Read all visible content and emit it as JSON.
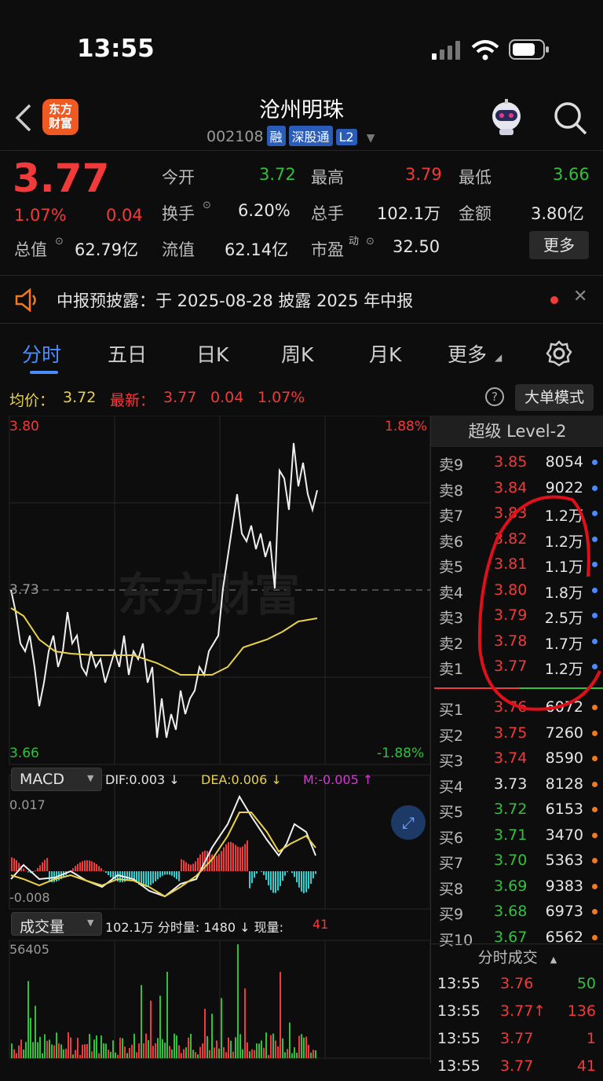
{
  "status_bar": {
    "time": "13:55"
  },
  "header": {
    "logo_text": "东方\n财富",
    "stock_name": "沧州明珠",
    "stock_code": "002108",
    "badges": [
      "融",
      "深股通",
      "L2"
    ]
  },
  "quote": {
    "price": "3.77",
    "change_pct": "1.07%",
    "change": "0.04",
    "fields": [
      {
        "label": "今开",
        "value": "3.72",
        "color": "green"
      },
      {
        "label": "最高",
        "value": "3.79",
        "color": "red"
      },
      {
        "label": "最低",
        "value": "3.66",
        "color": "green"
      },
      {
        "label": "换手",
        "value": "6.20%",
        "color": "white"
      },
      {
        "label": "总手",
        "value": "102.1万",
        "color": "white"
      },
      {
        "label": "金额",
        "value": "3.80亿",
        "color": "white"
      },
      {
        "label": "总值",
        "value": "62.79亿",
        "color": "white"
      },
      {
        "label": "流值",
        "value": "62.14亿",
        "color": "white"
      },
      {
        "label": "市盈",
        "value": "32.50",
        "color": "white"
      }
    ],
    "pe_superscript": "动",
    "more_button": "更多"
  },
  "notice": {
    "text": "中报预披露：于 2025-08-28 披露 2025 年中报"
  },
  "tabs": [
    "分时",
    "五日",
    "日K",
    "周K",
    "月K",
    "更多"
  ],
  "active_tab": 0,
  "infobar": {
    "avg_label": "均价：",
    "avg_value": "3.72",
    "latest_label": "最新：",
    "latest_value": "3.77",
    "latest_change": "0.04",
    "latest_pct": "1.07%",
    "mode_button": "大单模式"
  },
  "price_chart": {
    "y_top": "3.80",
    "y_mid": "3.73",
    "y_bottom": "3.66",
    "pct_top": "1.88%",
    "pct_bottom": "-1.88%",
    "watermark": "东方财富"
  },
  "macd": {
    "selector": "MACD",
    "dif": "DIF:0.003 ↓",
    "dea": "DEA:0.006 ↓",
    "m": "M:-0.005 ↑",
    "y_top": "0.017",
    "y_bottom": "-0.008"
  },
  "volume": {
    "selector": "成交量",
    "summary": "102.1万 分时量: 1480 ↓ 现量:",
    "current": "41",
    "y_top": "56405"
  },
  "level2": {
    "title": "超级 Level-2",
    "asks": [
      {
        "label": "卖9",
        "price": "3.85",
        "qty": "8054"
      },
      {
        "label": "卖8",
        "price": "3.84",
        "qty": "9022"
      },
      {
        "label": "卖7",
        "price": "3.83",
        "qty": "1.2万"
      },
      {
        "label": "卖6",
        "price": "3.82",
        "qty": "1.2万"
      },
      {
        "label": "卖5",
        "price": "3.81",
        "qty": "1.1万"
      },
      {
        "label": "卖4",
        "price": "3.80",
        "qty": "1.8万"
      },
      {
        "label": "卖3",
        "price": "3.79",
        "qty": "2.5万"
      },
      {
        "label": "卖2",
        "price": "3.78",
        "qty": "1.7万"
      },
      {
        "label": "卖1",
        "price": "3.77",
        "qty": "1.2万"
      }
    ],
    "bids": [
      {
        "label": "买1",
        "price": "3.76",
        "qty": "6072",
        "color": "red"
      },
      {
        "label": "买2",
        "price": "3.75",
        "qty": "7260",
        "color": "red"
      },
      {
        "label": "买3",
        "price": "3.74",
        "qty": "8590",
        "color": "red"
      },
      {
        "label": "买4",
        "price": "3.73",
        "qty": "8128",
        "color": "white"
      },
      {
        "label": "买5",
        "price": "3.72",
        "qty": "6153",
        "color": "green"
      },
      {
        "label": "买6",
        "price": "3.71",
        "qty": "3470",
        "color": "green"
      },
      {
        "label": "买7",
        "price": "3.70",
        "qty": "5363",
        "color": "green"
      },
      {
        "label": "买8",
        "price": "3.69",
        "qty": "9383",
        "color": "green"
      },
      {
        "label": "买9",
        "price": "3.68",
        "qty": "6973",
        "color": "green"
      },
      {
        "label": "买10",
        "price": "3.67",
        "qty": "6562",
        "color": "green"
      }
    ],
    "ticks_title": "分时成交",
    "ticks": [
      {
        "time": "13:55",
        "price": "3.76",
        "qty": "50",
        "qcolor": "green"
      },
      {
        "time": "13:55",
        "price": "3.77↑",
        "qty": "136",
        "qcolor": "red"
      },
      {
        "time": "13:55",
        "price": "3.77",
        "qty": "1",
        "qcolor": "red"
      },
      {
        "time": "13:55",
        "price": "3.77",
        "qty": "41",
        "qcolor": "red"
      }
    ]
  },
  "colors": {
    "up": "#f23a3a",
    "down": "#2fc23a",
    "accent": "#2b5cb8",
    "avg_line": "#e8d24a"
  }
}
